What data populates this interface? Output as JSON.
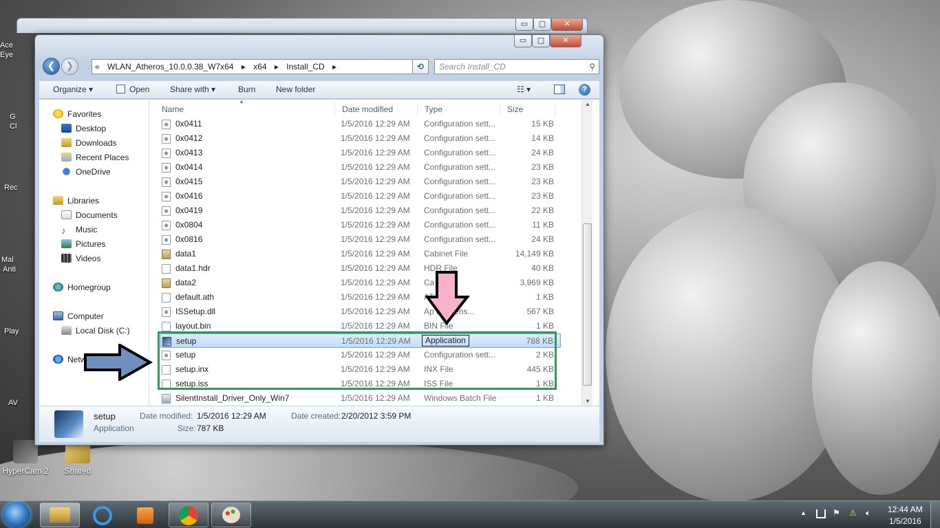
{
  "desktop": {
    "icons": [
      {
        "label": "HyperCam 2"
      },
      {
        "label": "Shared"
      }
    ],
    "edge_labels": [
      "Ace",
      "Eye",
      "G",
      "Cl",
      "Rec",
      "Mal",
      "Anti",
      "Play",
      "AV"
    ]
  },
  "window": {
    "caption_buttons": {
      "minimize": "▭",
      "maximize": "□",
      "close": "✕"
    },
    "back_button": "❮",
    "forward_button": "❯",
    "breadcrumb": [
      "«",
      "WLAN_Atheros_10.0.0.38_W7x64",
      "▸",
      "x64",
      "▸",
      "Install_CD",
      "▸"
    ],
    "search_placeholder": "Search Install_CD",
    "toolbar": {
      "organize": "Organize ▾",
      "open": "Open",
      "share_with": "Share with ▾",
      "burn": "Burn",
      "new_folder": "New folder"
    },
    "nav": {
      "favorites": "Favorites",
      "desktop": "Desktop",
      "downloads": "Downloads",
      "recent_places": "Recent Places",
      "onedrive": "OneDrive",
      "libraries": "Libraries",
      "documents": "Documents",
      "music": "Music",
      "pictures": "Pictures",
      "videos": "Videos",
      "homegroup": "Homegroup",
      "computer": "Computer",
      "local_disk": "Local Disk (C:)",
      "network": "Netw"
    },
    "columns": {
      "name": "Name",
      "date": "Date modified",
      "type": "Type",
      "size": "Size"
    },
    "files": [
      {
        "name": "0x0411",
        "date": "1/5/2016 12:29 AM",
        "type": "Configuration sett...",
        "size": "15 KB",
        "icon": "cfg"
      },
      {
        "name": "0x0412",
        "date": "1/5/2016 12:29 AM",
        "type": "Configuration sett...",
        "size": "14 KB",
        "icon": "cfg"
      },
      {
        "name": "0x0413",
        "date": "1/5/2016 12:29 AM",
        "type": "Configuration sett...",
        "size": "24 KB",
        "icon": "cfg"
      },
      {
        "name": "0x0414",
        "date": "1/5/2016 12:29 AM",
        "type": "Configuration sett...",
        "size": "23 KB",
        "icon": "cfg"
      },
      {
        "name": "0x0415",
        "date": "1/5/2016 12:29 AM",
        "type": "Configuration sett...",
        "size": "23 KB",
        "icon": "cfg"
      },
      {
        "name": "0x0416",
        "date": "1/5/2016 12:29 AM",
        "type": "Configuration sett...",
        "size": "23 KB",
        "icon": "cfg"
      },
      {
        "name": "0x0419",
        "date": "1/5/2016 12:29 AM",
        "type": "Configuration sett...",
        "size": "22 KB",
        "icon": "cfg"
      },
      {
        "name": "0x0804",
        "date": "1/5/2016 12:29 AM",
        "type": "Configuration sett...",
        "size": "11 KB",
        "icon": "cfg"
      },
      {
        "name": "0x0816",
        "date": "1/5/2016 12:29 AM",
        "type": "Configuration sett...",
        "size": "24 KB",
        "icon": "cfg"
      },
      {
        "name": "data1",
        "date": "1/5/2016 12:29 AM",
        "type": "Cabinet File",
        "size": "14,149 KB",
        "icon": "cab"
      },
      {
        "name": "data1.hdr",
        "date": "1/5/2016 12:29 AM",
        "type": "HDR File",
        "size": "40 KB",
        "icon": "blank"
      },
      {
        "name": "data2",
        "date": "1/5/2016 12:29 AM",
        "type": "Ca          ile",
        "size": "3,969 KB",
        "icon": "cab"
      },
      {
        "name": "default.ath",
        "date": "1/5/2016 12:29 AM",
        "type": "AT",
        "size": "1 KB",
        "icon": "blank"
      },
      {
        "name": "ISSetup.dll",
        "date": "1/5/2016 12:29 AM",
        "type": "Ap        n extens...",
        "size": "567 KB",
        "icon": "cfg"
      },
      {
        "name": "layout.bin",
        "date": "1/5/2016 12:29 AM",
        "type": "BIN File",
        "size": "1 KB",
        "icon": "blank"
      },
      {
        "name": "setup",
        "date": "1/5/2016 12:29 AM",
        "type": "Application",
        "size": "788 KB",
        "icon": "app",
        "selected": true
      },
      {
        "name": "setup",
        "date": "1/5/2016 12:29 AM",
        "type": "Configuration sett...",
        "size": "2 KB",
        "icon": "cfg"
      },
      {
        "name": "setup.inx",
        "date": "1/5/2016 12:29 AM",
        "type": "INX File",
        "size": "445 KB",
        "icon": "blank"
      },
      {
        "name": "setup.iss",
        "date": "1/5/2016 12:29 AM",
        "type": "ISS File",
        "size": "1 KB",
        "icon": "blank"
      },
      {
        "name": "SilentInstall_Driver_Only_Win7",
        "date": "1/5/2016 12:29 AM",
        "type": "Windows Batch File",
        "size": "1 KB",
        "icon": "bat"
      }
    ],
    "details": {
      "name": "setup",
      "kind": "Application",
      "date_modified_label": "Date modified:",
      "date_modified": "1/5/2016 12:29 AM",
      "date_created_label": "Date created:",
      "date_created": "2/20/2012 3:59 PM",
      "size_label": "Size:",
      "size": "787 KB"
    }
  },
  "taskbar": {
    "time": "12:44 AM",
    "date": "1/5/2016"
  },
  "colors": {
    "highlight_box": "#2e9a52",
    "pink_arrow": "#f7b3cd",
    "blue_arrow": "#6f8fbf"
  }
}
